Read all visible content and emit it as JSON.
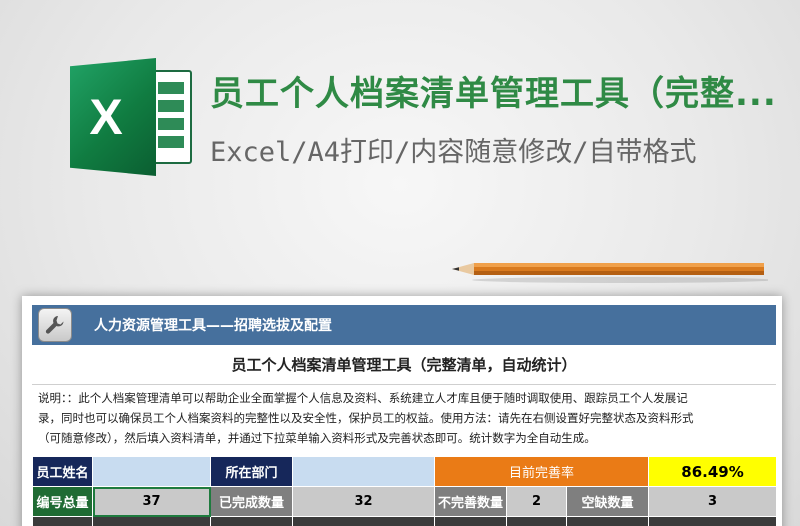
{
  "header": {
    "title": "员工个人档案清单管理工具（完整...",
    "subtitle": "Excel/A4打印/内容随意修改/自带格式"
  },
  "logo": {
    "letter": "X",
    "icon": "excel-logo-icon"
  },
  "sheet": {
    "banner_title": "人力资源管理工具——招聘选拔及配置",
    "tool_icon": "wrench-icon",
    "title": "员工个人档案清单管理工具（完整清单，自动统计）",
    "description": [
      "说明：：此个人档案管理清单可以帮助企业全面掌握个人信息及资料、系统建立人才库且便于随时调取使用、跟踪员工个人发展记",
      "录，同时也可以确保员工个人档案资料的完整性以及安全性，保护员工的权益。使用方法：请先在右侧设置好完整状态及资料形式",
      "（可随意修改），然后填入资料清单，并通过下拉菜单输入资料形式及完善状态即可。统计数字为全自动生成。"
    ],
    "row1": {
      "name_label": "员工姓名",
      "name_value": "",
      "dept_label": "所在部门",
      "dept_value": "",
      "rate_label": "目前完善率",
      "rate_value": "86.49%"
    },
    "row2": {
      "total_label": "编号总量",
      "total_value": "37",
      "done_label": "已完成数量",
      "done_value": "32",
      "incomplete_label": "不完善数量",
      "incomplete_value": "2",
      "missing_label": "空缺数量",
      "missing_value": "3"
    }
  },
  "colors": {
    "excel_green": "#107c41",
    "title_green": "#2f8a45",
    "banner_blue": "#46709d",
    "navy": "#16275a",
    "orange": "#ea7b16",
    "yellow": "#ffff00"
  }
}
